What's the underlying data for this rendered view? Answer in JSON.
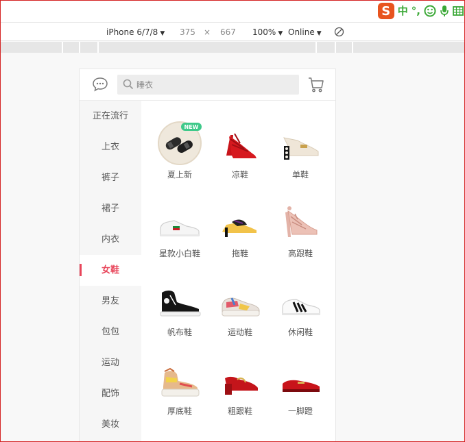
{
  "ime": {
    "logo": "S",
    "lang": "中",
    "punct": "°,",
    "icons": [
      "smiley-icon",
      "microphone-icon",
      "keyboard-icon"
    ]
  },
  "device_toolbar": {
    "device": "iPhone 6/7/8",
    "width": "375",
    "times": "×",
    "height": "667",
    "zoom": "100%",
    "network": "Online",
    "caret": "▼"
  },
  "header": {
    "search_placeholder": "睡衣"
  },
  "sidebar": {
    "active_index": 5,
    "items": [
      {
        "label": "正在流行"
      },
      {
        "label": "上衣"
      },
      {
        "label": "裤子"
      },
      {
        "label": "裙子"
      },
      {
        "label": "内衣"
      },
      {
        "label": "女鞋"
      },
      {
        "label": "男友"
      },
      {
        "label": "包包"
      },
      {
        "label": "运动"
      },
      {
        "label": "配饰"
      },
      {
        "label": "美妆"
      }
    ]
  },
  "categories": [
    {
      "label": "夏上新",
      "badge": "NEW",
      "icon": "sandals-new-icon"
    },
    {
      "label": "凉鞋",
      "icon": "red-strappy-heel-icon"
    },
    {
      "label": "单鞋",
      "icon": "pearl-heel-loafer-icon"
    },
    {
      "label": "星款小白鞋",
      "icon": "white-sneaker-icon"
    },
    {
      "label": "拖鞋",
      "icon": "mule-slipper-icon"
    },
    {
      "label": "高跟鞋",
      "icon": "pink-lace-heel-icon"
    },
    {
      "label": "帆布鞋",
      "icon": "canvas-hightop-icon"
    },
    {
      "label": "运动鞋",
      "icon": "chunky-sneaker-icon"
    },
    {
      "label": "休闲鞋",
      "icon": "striped-sneaker-icon"
    },
    {
      "label": "厚底鞋",
      "icon": "platform-sneaker-icon"
    },
    {
      "label": "粗跟鞋",
      "icon": "red-block-heel-icon"
    },
    {
      "label": "一脚蹬",
      "icon": "red-loafer-icon"
    }
  ],
  "colors": {
    "accent": "#e8455a",
    "ime_orange": "#e8541e",
    "ime_green": "#3aa836",
    "new_badge": "#3ec98a"
  }
}
